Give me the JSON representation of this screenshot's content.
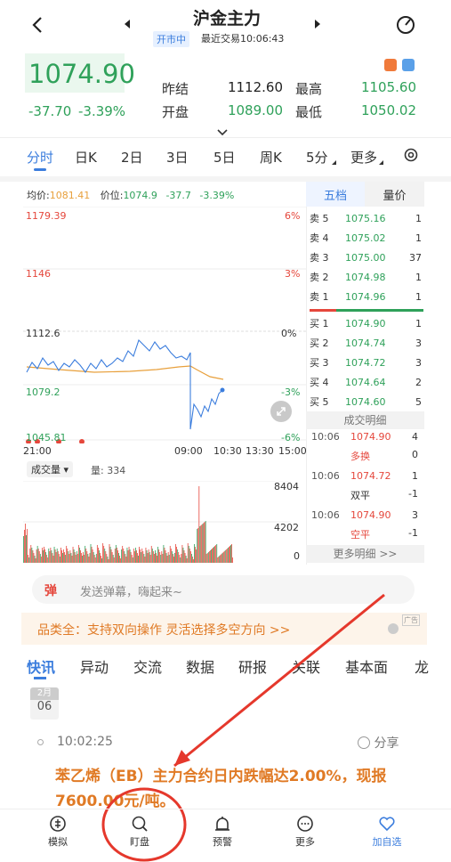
{
  "header": {
    "title": "沪金主力",
    "status": "开市中",
    "last_trade": "最近交易10:06:43"
  },
  "quote": {
    "price": "1074.90",
    "change": "-37.70",
    "change_pct": "-3.39%",
    "prev_close_label": "昨结",
    "prev_close": "1112.60",
    "open_label": "开盘",
    "open": "1089.00",
    "high_label": "最高",
    "high": "1105.60",
    "low_label": "最低",
    "low": "1050.02"
  },
  "tabs": [
    "分时",
    "日K",
    "2日",
    "3日",
    "5日",
    "周K",
    "5分",
    "更多"
  ],
  "chart": {
    "avg_label": "均价:",
    "avg_value": "1081.41",
    "price_label": "价位:",
    "price_value": "1074.9",
    "change_value": "-37.7",
    "pct_value": "-3.39%",
    "y_left": [
      "1179.39",
      "1146",
      "1112.6",
      "1079.2",
      "1045.81"
    ],
    "y_right": [
      "6%",
      "3%",
      "0%",
      "-3%",
      "-6%"
    ],
    "x_labels": [
      "21:00",
      "09:00",
      "10:30",
      "13:30",
      "15:00"
    ],
    "volume_selector": "成交量",
    "volume_label": "量: 334",
    "volume_axis": [
      "8404",
      "4202",
      "0"
    ],
    "colors": {
      "red": "#e5473c",
      "green": "#2fa15a",
      "blue": "#3b7ddd"
    }
  },
  "order_book": {
    "tabs": [
      "五档",
      "量价"
    ],
    "asks": [
      {
        "label": "卖 5",
        "price": "1075.16",
        "vol": "1"
      },
      {
        "label": "卖 4",
        "price": "1075.02",
        "vol": "1"
      },
      {
        "label": "卖 3",
        "price": "1075.00",
        "vol": "37"
      },
      {
        "label": "卖 2",
        "price": "1074.98",
        "vol": "1"
      },
      {
        "label": "卖 1",
        "price": "1074.96",
        "vol": "1"
      }
    ],
    "bids": [
      {
        "label": "买 1",
        "price": "1074.90",
        "vol": "1"
      },
      {
        "label": "买 2",
        "price": "1074.74",
        "vol": "3"
      },
      {
        "label": "买 3",
        "price": "1074.72",
        "vol": "3"
      },
      {
        "label": "买 4",
        "price": "1074.64",
        "vol": "2"
      },
      {
        "label": "买 5",
        "price": "1074.60",
        "vol": "5"
      }
    ],
    "trades_header": "成交明细",
    "trades": [
      {
        "time": "10:06",
        "price": "1074.90",
        "vol": "4",
        "type": "多换",
        "vol2": "0"
      },
      {
        "time": "10:06",
        "price": "1074.72",
        "vol": "1",
        "type": "双平",
        "vol2": "-1"
      },
      {
        "time": "10:06",
        "price": "1074.90",
        "vol": "3",
        "type": "空平",
        "vol2": "-1"
      }
    ],
    "more_trades": "更多明细 >>"
  },
  "danmaku": {
    "icon": "弹",
    "placeholder": "发送弹幕，嗨起来~"
  },
  "promo": {
    "text": "品类全：支持双向操作 灵活选择多空方向 >>",
    "ad": "广告"
  },
  "news_tabs": [
    "快讯",
    "异动",
    "交流",
    "数据",
    "研报",
    "关联",
    "基本面",
    "龙"
  ],
  "news": {
    "month": "2月",
    "day": "06",
    "time": "10:02:25",
    "share": "分享",
    "headline": "苯乙烯（EB）主力合约日内跌幅达2.00%，现报7600.00元/吨。"
  },
  "bottom_bar": [
    {
      "label": "模拟",
      "icon": "simulate-icon"
    },
    {
      "label": "盯盘",
      "icon": "watch-icon"
    },
    {
      "label": "预警",
      "icon": "alarm-icon"
    },
    {
      "label": "更多",
      "icon": "more-icon"
    },
    {
      "label": "加自选",
      "icon": "heart-plus-icon"
    }
  ]
}
